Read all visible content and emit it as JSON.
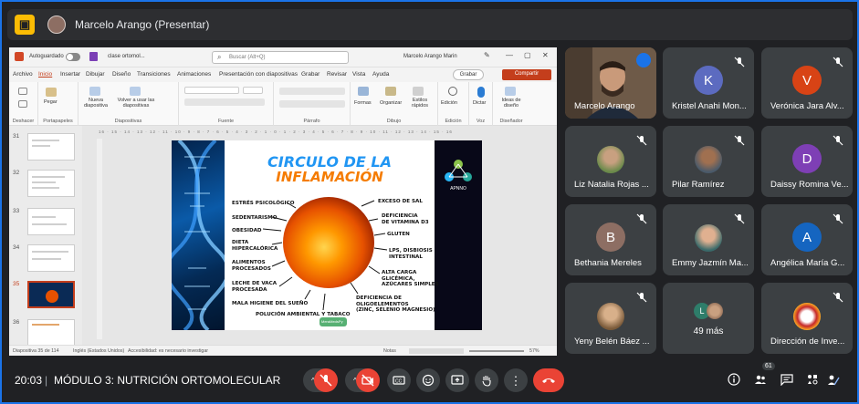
{
  "colors": {
    "accent": "#1a73e8",
    "mic_off": "#ea4335",
    "present_badge": "#fbbc04",
    "ppt_accent": "#c43e1c"
  },
  "topbar": {
    "title": "Marcelo Arango (Presentar)",
    "icon": "present-to-all-icon"
  },
  "ppt": {
    "autosave_label": "Autoguardado",
    "file_name": "clase ortomol...",
    "search_placeholder": "Buscar (Alt+Q)",
    "user_name": "Marcelo Arango Marin",
    "tabs": [
      "Archivo",
      "Inicio",
      "Insertar",
      "Dibujar",
      "Diseño",
      "Transiciones",
      "Animaciones",
      "Presentación con diapositivas",
      "Grabar",
      "Revisar",
      "Vista",
      "Ayuda"
    ],
    "active_tab": "Inicio",
    "grabar_label": "Grabar",
    "share_label": "Compartir",
    "ribbon_groups": [
      "Deshacer",
      "Portapapeles",
      "Diapositivas",
      "Fuente",
      "Párrafo",
      "Dibujo",
      "Edición",
      "Voz",
      "Diseñador"
    ],
    "ribbon_buttons": {
      "pegar": "Pegar",
      "nueva": "Nueva diapositiva",
      "volver": "Volver a usar las diapositivas",
      "formas": "Formas",
      "organizar": "Organizar",
      "estilos": "Estilos rápidos",
      "edicion": "Edición",
      "dictar": "Dictar",
      "ideas": "Ideas de diseño"
    },
    "thumbnails": [
      "31",
      "32",
      "33",
      "34",
      "35",
      "36"
    ],
    "selected_thumbnail": "35",
    "status_slide": "Diapositiva 35 de 114",
    "status_lang": "Inglés (Estados Unidos)",
    "status_access": "Accesibilidad: es necesario investigar",
    "status_notes": "Notas",
    "zoom": "57%"
  },
  "slide": {
    "title_line1": "CIRCULO DE LA",
    "title_line2": "INFLAMACIÓN",
    "left_labels": [
      "ESTRÉS PSICOLÓGICO",
      "SEDENTARISMO",
      "OBESIDAD",
      "DIETA\nHIPERCALÓRICA",
      "ALIMENTOS\nPROCESADOS",
      "LECHE DE VACA\nPROCESADA",
      "MALA HIGIENE DEL SUEÑO",
      "POLUCIÓN AMBIENTAL Y TABACO"
    ],
    "right_labels": [
      "EXCESO DE SAL",
      "DEFICIENCIA\nDE VITAMINA D3",
      "GLUTEN",
      "LPS, DISBIOSIS\nINTESTINAL",
      "ALTA CARGA\nGLICÉMICA,\nAZÚCARES SIMPLES",
      "DEFICIENCIA DE\nOLIGOELEMENTOS\n(ZINC, SELENIO MAGNESIO)"
    ],
    "logo_text": "APNNO",
    "bottom_logo": "MeraMedsPy"
  },
  "participants": [
    {
      "name": "Marcelo Arango",
      "type": "video",
      "speaking": true
    },
    {
      "name": "Kristel Anahi Mon...",
      "initial": "K",
      "color": "#5c6bc0"
    },
    {
      "name": "Verónica Jara Alv...",
      "initial": "V",
      "color": "#d84315"
    },
    {
      "name": "Liz Natalia Rojas ...",
      "type": "photo"
    },
    {
      "name": "Pilar Ramírez",
      "type": "photo"
    },
    {
      "name": "Daissy Romina Ve...",
      "initial": "D",
      "color": "#7e3fb5"
    },
    {
      "name": "Bethania Mereles",
      "initial": "B",
      "color": "#8d6e63"
    },
    {
      "name": "Emmy Jazmín Ma...",
      "type": "photo"
    },
    {
      "name": "Angélica María G...",
      "initial": "A",
      "color": "#1565c0"
    },
    {
      "name": "Yeny Belén Báez ...",
      "type": "photo"
    },
    {
      "name": "49 más",
      "type": "more",
      "initial": "L"
    },
    {
      "name": "Dirección de Inve...",
      "type": "photo"
    }
  ],
  "bottombar": {
    "time": "20:03",
    "separator": "|",
    "meeting_name": "MÓDULO 3: NUTRICIÓN ORTOMOLECULAR",
    "participants_count": "61"
  }
}
